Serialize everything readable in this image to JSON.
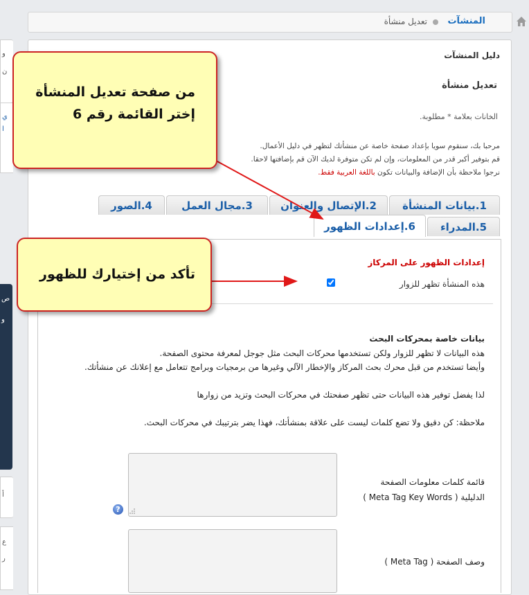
{
  "breadcrumb": {
    "home_link": "المنشآت",
    "current": "تعديل منشأة"
  },
  "page": {
    "directory_title": "دليل المنشآت",
    "edit_title": "تعديل منشأة",
    "required_note": "الخانات بعلامة * مطلوبة.",
    "intro_line1": "مرحبا بك، سنقوم سويا بإعداد صفحة خاصة عن منشأتك لتظهر في دليل الأعمال.",
    "intro_line2": "قم بتوفير أكبر قدر من المعلومات، وإن لم تكن متوفرة لديك الآن قم بإضافتها لاحقا.",
    "intro_line3_prefix": "نرجوا ملاحظة بأن الإضافة والبيانات تكون ",
    "intro_line3_highlight": "باللغة العربية فقط."
  },
  "tabs": [
    {
      "label": "1.بيانات المنشأة"
    },
    {
      "label": "2.الإتصال والعنوان"
    },
    {
      "label": "3.مجال العمل"
    },
    {
      "label": "4.الصور"
    },
    {
      "label": "5.المدراء"
    },
    {
      "label": "6.إعدادات الظهور",
      "active": true
    }
  ],
  "display_settings": {
    "heading": "إعدادات الظهور على المركاز",
    "visible_label": "هذه المنشأة تظهر للزوار",
    "visible_checked": true
  },
  "seo": {
    "heading": "بيانات خاصة بمحركات البحث",
    "line1": "هذه البيانات لا تظهر للزوار ولكن تستخدمها محركات البحث مثل جوجل لمعرفة محتوى الصفحة.",
    "line2": "وأيضا تستخدم من قبل محرك بحث المركاز والإخطار الآلي وغيرها من برمجيات وبرامج تتعامل مع إعلانك عن منشأتك.",
    "line3": "لذا يفضل توفير هذه البيانات حتى تظهر صفحتك في محركات البحث وتزيد من زوارها",
    "note": "ملاحظة: كن دقيق ولا تضع كلمات ليست على علاقة بمنشأتك، فهذا يضر بترتيبك في محركات البحث.",
    "keywords_label_line1": "قائمة كلمات معلومات الصفحة",
    "keywords_label_line2": "الدليلية ( Meta Tag Key Words )",
    "keywords_value": "",
    "description_label": "وصف الصفحة ( Meta Tag )",
    "description_value": "",
    "help_glyph": "?"
  },
  "callouts": {
    "callout1_line1": "من صفحة تعديل المنشأة",
    "callout1_line2": "إختر القائمة رقم 6",
    "callout2": "تأكد من إختيارك للظهور"
  },
  "sidebar": {
    "fragments": [
      "و",
      "ن",
      "ي",
      "ا",
      "ص",
      "و",
      "أ",
      "ع",
      "ر"
    ]
  },
  "colors": {
    "link_blue": "#1a5ea8",
    "required_red": "#cc0000",
    "callout_fill": "#fffeb5",
    "callout_border": "#cc2222",
    "sidebar_dark": "#23364d"
  },
  "icons": {
    "home": "home-icon",
    "help": "help-icon",
    "resize": "resize-grip-icon"
  }
}
